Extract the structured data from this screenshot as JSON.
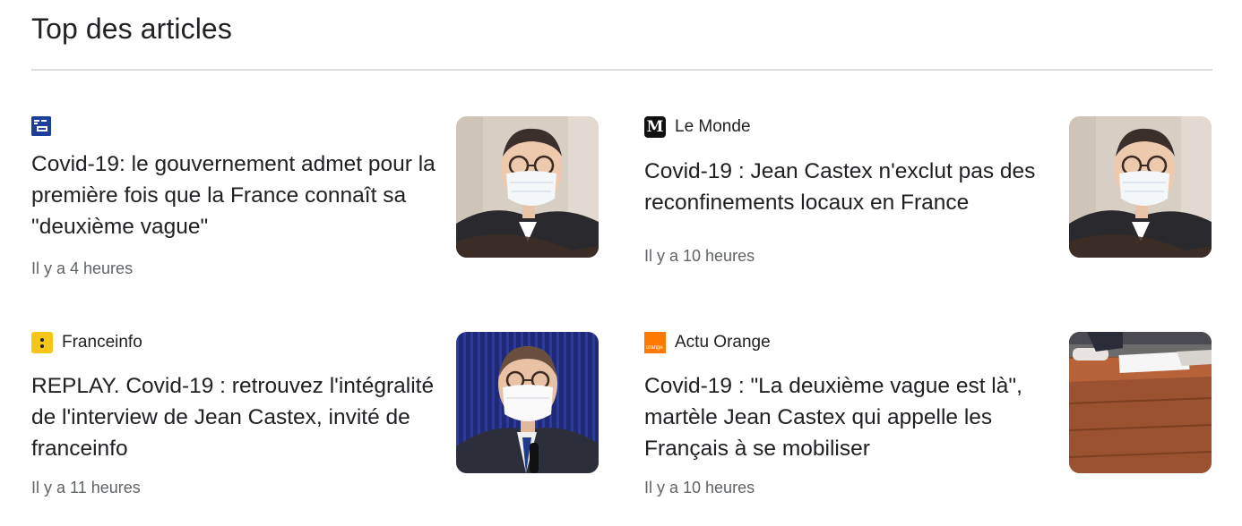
{
  "section": {
    "title": "Top des articles"
  },
  "articles": [
    {
      "source": "",
      "logo": "bfmtv-logo",
      "headline": "Covid-19: le gouvernement admet pour la première fois que la France connaît sa \"deuxième vague\"",
      "time": "Il y a 4 heures",
      "image": "masked-man-thumbnail"
    },
    {
      "source": "Le Monde",
      "logo": "le-monde-logo",
      "headline": "Covid-19 : Jean Castex n'exclut pas des reconfinements locaux en France",
      "time": "Il y a 10 heures",
      "image": "masked-man-thumbnail"
    },
    {
      "source": "Franceinfo",
      "logo": "franceinfo-logo",
      "headline": "REPLAY. Covid-19 : retrouvez l'intégralité de l'interview de Jean Castex, invité de franceinfo",
      "time": "Il y a 11 heures",
      "image": "interview-thumbnail"
    },
    {
      "source": "Actu Orange",
      "logo": "orange-logo",
      "headline": "Covid-19 : \"La deuxième vague est là\", martèle Jean Castex qui appelle les Français à se mobiliser",
      "time": "Il y a 10 heures",
      "image": "assembly-desk-thumbnail"
    }
  ],
  "colors": {
    "bfmtv": "#1d3f9a",
    "lemonde": "#111111",
    "franceinfo": "#f5c518",
    "orange": "#ff7900",
    "divider": "#dadce0",
    "meta_text": "#5f6368"
  }
}
